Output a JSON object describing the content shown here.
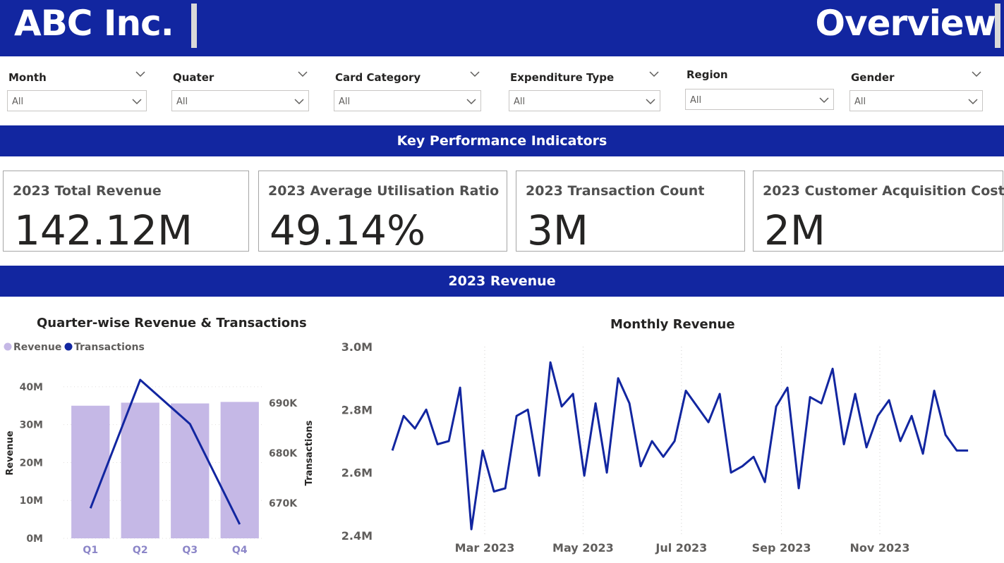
{
  "header": {
    "company": "ABC Inc.",
    "page_title": "Overview"
  },
  "filters": [
    {
      "label": "Month",
      "value": "All"
    },
    {
      "label": "Quater",
      "value": "All"
    },
    {
      "label": "Card Category",
      "value": "All"
    },
    {
      "label": "Expenditure Type",
      "value": "All"
    },
    {
      "label": "Region",
      "value": "All"
    },
    {
      "label": "Gender",
      "value": "All"
    }
  ],
  "sections": {
    "kpi_title": "Key Performance Indicators",
    "revenue_title": "2023 Revenue"
  },
  "kpis": [
    {
      "label": "2023 Total Revenue",
      "value": "142.12M"
    },
    {
      "label": "2023 Average Utilisation Ratio",
      "value": "49.14%"
    },
    {
      "label": "2023 Transaction Count",
      "value": "3M"
    },
    {
      "label": "2023 Customer Acquisition Cost",
      "value": "2M"
    }
  ],
  "colors": {
    "brand": "#1226a0",
    "bar": "#c5b8e6",
    "line": "#1226a0",
    "axis_text": "#605e5c",
    "category_text": "#8c86c8"
  },
  "chart_data": [
    {
      "type": "bar",
      "title": "Quarter-wise Revenue & Transactions",
      "categories": [
        "Q1",
        "Q2",
        "Q3",
        "Q4"
      ],
      "series": [
        {
          "name": "Revenue",
          "type": "bar",
          "axis": "left",
          "values": [
            35.0,
            35.8,
            35.6,
            36.0
          ]
        },
        {
          "name": "Transactions",
          "type": "line",
          "axis": "right",
          "values": [
            669000,
            694600,
            685800,
            665800
          ]
        }
      ],
      "ylabel": "Revenue",
      "y2label": "Transactions",
      "ylim": [
        0,
        45
      ],
      "yticks": [
        "0M",
        "10M",
        "20M",
        "30M",
        "40M"
      ],
      "y2lim": [
        663000,
        697000
      ],
      "y2ticks": [
        "670K",
        "680K",
        "690K"
      ],
      "legend": "top-left",
      "grid": true
    },
    {
      "type": "line",
      "title": "Monthly Revenue",
      "series": [
        {
          "name": "Revenue",
          "start_date": "2023-01-01",
          "step_days": 7,
          "values": [
            2.67,
            2.78,
            2.74,
            2.8,
            2.69,
            2.7,
            2.87,
            2.42,
            2.67,
            2.54,
            2.55,
            2.78,
            2.8,
            2.59,
            2.95,
            2.81,
            2.85,
            2.59,
            2.82,
            2.6,
            2.9,
            2.82,
            2.62,
            2.7,
            2.65,
            2.7,
            2.86,
            2.81,
            2.76,
            2.85,
            2.6,
            2.62,
            2.65,
            2.57,
            2.81,
            2.87,
            2.55,
            2.84,
            2.82,
            2.93,
            2.69,
            2.85,
            2.68,
            2.78,
            2.83,
            2.7,
            2.78,
            2.66,
            2.86,
            2.72,
            2.67,
            2.67
          ]
        }
      ],
      "xticks": [
        "Mar 2023",
        "May 2023",
        "Jul 2023",
        "Sep 2023",
        "Nov 2023"
      ],
      "yticks": [
        "2.4M",
        "2.6M",
        "2.8M",
        "3.0M"
      ],
      "ylim": [
        2.4,
        3.0
      ],
      "grid": true
    }
  ]
}
